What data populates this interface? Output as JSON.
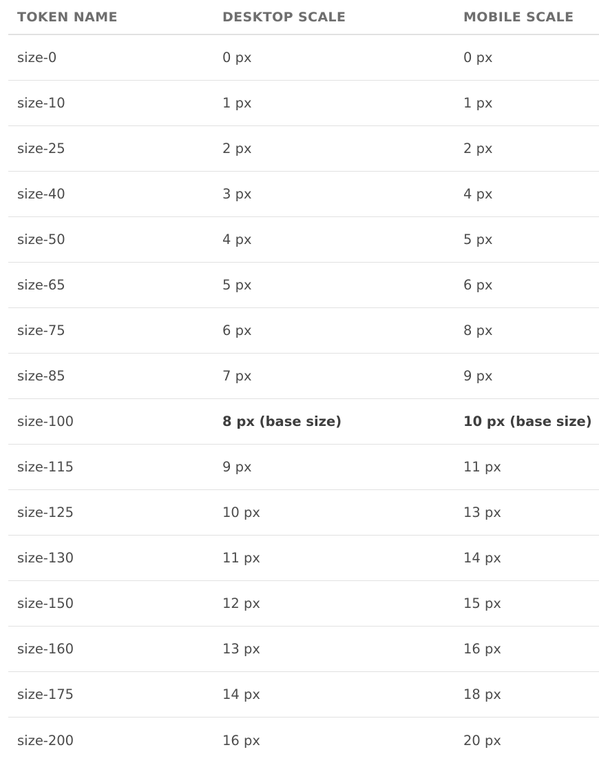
{
  "table": {
    "headers": [
      "TOKEN NAME",
      "DESKTOP SCALE",
      "MOBILE SCALE"
    ],
    "rows": [
      {
        "token": "size-0",
        "desktop": "0 px",
        "mobile": "0 px",
        "emphasis": false
      },
      {
        "token": "size-10",
        "desktop": "1 px",
        "mobile": "1 px",
        "emphasis": false
      },
      {
        "token": "size-25",
        "desktop": "2 px",
        "mobile": "2 px",
        "emphasis": false
      },
      {
        "token": "size-40",
        "desktop": "3 px",
        "mobile": "4 px",
        "emphasis": false
      },
      {
        "token": "size-50",
        "desktop": "4 px",
        "mobile": "5 px",
        "emphasis": false
      },
      {
        "token": "size-65",
        "desktop": "5 px",
        "mobile": "6 px",
        "emphasis": false
      },
      {
        "token": "size-75",
        "desktop": "6 px",
        "mobile": "8 px",
        "emphasis": false
      },
      {
        "token": "size-85",
        "desktop": "7 px",
        "mobile": "9 px",
        "emphasis": false
      },
      {
        "token": "size-100",
        "desktop": "8 px (base size)",
        "mobile": "10 px (base size)",
        "emphasis": true
      },
      {
        "token": "size-115",
        "desktop": "9 px",
        "mobile": "11 px",
        "emphasis": false
      },
      {
        "token": "size-125",
        "desktop": "10 px",
        "mobile": "13 px",
        "emphasis": false
      },
      {
        "token": "size-130",
        "desktop": "11 px",
        "mobile": "14 px",
        "emphasis": false
      },
      {
        "token": "size-150",
        "desktop": "12 px",
        "mobile": "15 px",
        "emphasis": false
      },
      {
        "token": "size-160",
        "desktop": "13 px",
        "mobile": "16 px",
        "emphasis": false
      },
      {
        "token": "size-175",
        "desktop": "14 px",
        "mobile": "18 px",
        "emphasis": false
      },
      {
        "token": "size-200",
        "desktop": "16 px",
        "mobile": "20 px",
        "emphasis": false
      }
    ]
  }
}
